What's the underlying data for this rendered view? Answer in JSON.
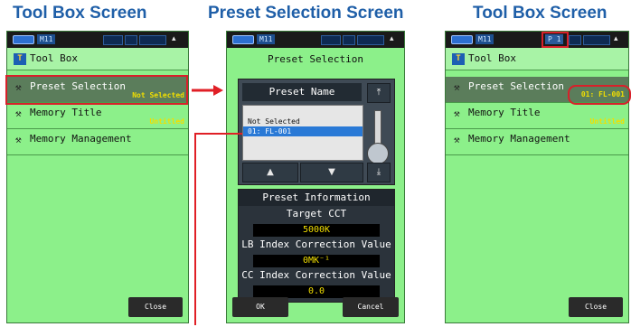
{
  "captions": {
    "left": "Tool Box Screen",
    "middle": "Preset Selection Screen",
    "right": "Tool Box Screen"
  },
  "toolbox_left": {
    "memory_indicator": "M11",
    "title": "Tool Box",
    "items": [
      {
        "label": "Preset Selection",
        "value": "Not Selected"
      },
      {
        "label": "Memory Title",
        "value": "Untitled"
      },
      {
        "label": "Memory Management",
        "value": ""
      }
    ],
    "close_label": "Close"
  },
  "preset_screen": {
    "memory_indicator": "M11",
    "title": "Preset Selection",
    "list_header": "Preset Name",
    "list_items": [
      "Not Selected",
      "01: FL-001"
    ],
    "selected_index": 1,
    "info_header": "Preset Information",
    "target_cct_label": "Target CCT",
    "target_cct_value": "5000K",
    "lb_label": "LB Index Correction Value",
    "lb_value": "0MK⁻¹",
    "cc_label": "CC Index Correction Value",
    "cc_value": "0.0",
    "ok_label": "OK",
    "cancel_label": "Cancel"
  },
  "toolbox_right": {
    "memory_indicator": "M11",
    "preset_indicator": "P 1",
    "title": "Tool Box",
    "items": [
      {
        "label": "Preset Selection",
        "value": "01: FL-001"
      },
      {
        "label": "Memory Title",
        "value": "Untitled"
      },
      {
        "label": "Memory Management",
        "value": ""
      }
    ],
    "close_label": "Close"
  },
  "colors": {
    "caption": "#1f5fa8",
    "screen_bg": "#8cf08a",
    "highlight": "#d8202a",
    "value_text": "#f2df00"
  },
  "icons": [
    "battery-icon",
    "toolbox-icon",
    "wrench-icon",
    "scroll-top-icon",
    "scroll-bottom-icon",
    "arrow-up-icon",
    "arrow-down-icon",
    "arrow-right-icon"
  ]
}
